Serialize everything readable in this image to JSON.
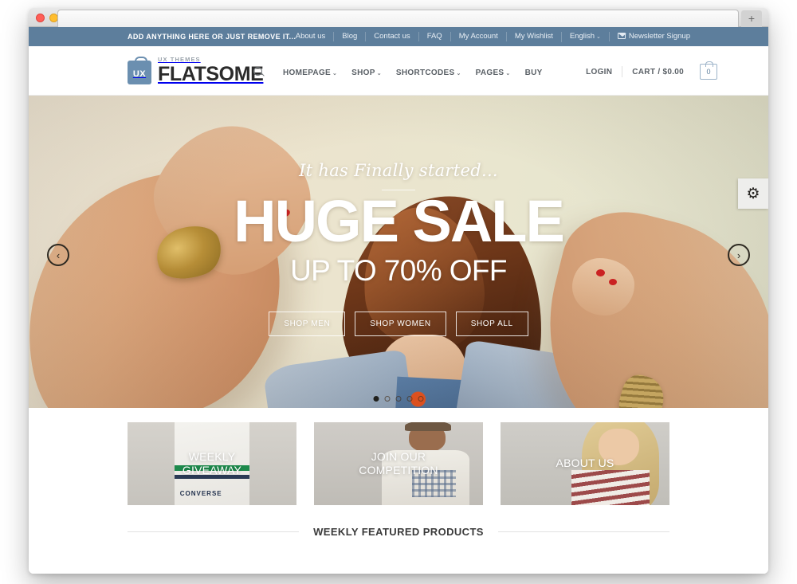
{
  "browser": {
    "new_tab_label": "+"
  },
  "topbar": {
    "promo_text": "ADD ANYTHING HERE OR JUST REMOVE IT...",
    "links": [
      {
        "label": "About us"
      },
      {
        "label": "Blog"
      },
      {
        "label": "Contact us"
      },
      {
        "label": "FAQ"
      },
      {
        "label": "My Account"
      },
      {
        "label": "My Wishlist"
      },
      {
        "label": "English",
        "caret": "⌄"
      },
      {
        "label": "Newsletter Signup",
        "icon": "envelope-icon"
      }
    ],
    "background_color": "#5d7e9c"
  },
  "header": {
    "logo": {
      "badge": "UX",
      "sub": "UX THEMES",
      "main": "FLATSOME"
    },
    "search_icon": "search-icon",
    "nav": [
      {
        "label": "HOMEPAGE",
        "caret": "⌄"
      },
      {
        "label": "SHOP",
        "caret": "⌄"
      },
      {
        "label": "SHORTCODES",
        "caret": "⌄"
      },
      {
        "label": "PAGES",
        "caret": "⌄"
      },
      {
        "label": "BUY",
        "caret": ""
      }
    ],
    "login_label": "LOGIN",
    "cart_label": "CART / $0.00",
    "cart_count": "0"
  },
  "hero": {
    "script_line": "It has Finally started...",
    "headline": "HUGE SALE",
    "subheadline": "UP TO 70% OFF",
    "buttons": [
      {
        "label": "SHOP MEN"
      },
      {
        "label": "SHOP WOMEN"
      },
      {
        "label": "SHOP ALL"
      }
    ],
    "prev_arrow": "‹",
    "next_arrow": "›",
    "gear_glyph": "⚙",
    "dots": [
      {
        "active": true
      },
      {
        "active": false
      },
      {
        "active": false
      },
      {
        "active": false
      },
      {
        "active": false
      }
    ]
  },
  "promos": [
    {
      "label": "WEEKLY\nGIVEAWAY",
      "brand": "CONVERSE"
    },
    {
      "label": "JOIN OUR\nCOMPETITION"
    },
    {
      "label": "ABOUT US"
    }
  ],
  "featured": {
    "title": "WEEKLY FEATURED PRODUCTS"
  }
}
